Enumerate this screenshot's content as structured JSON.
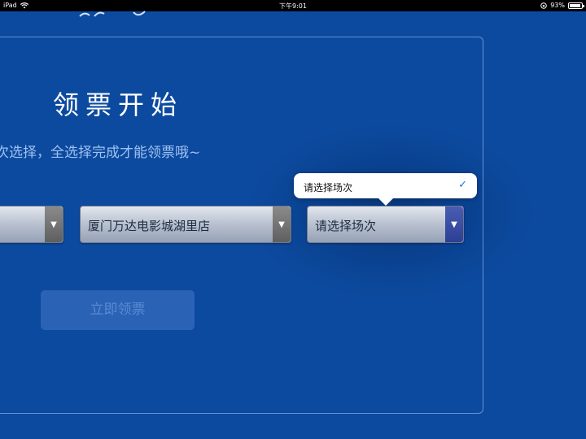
{
  "status_bar": {
    "device": "iPad",
    "wifi_icon": "wifi-icon",
    "time": "下午9:01",
    "battery_percent": "93%",
    "battery_level": 0.93,
    "rotation_lock_icon": "rotation-lock-icon"
  },
  "main": {
    "title": "领票开始",
    "subtitle": "次选择，全选择完成才能领票哦~",
    "selects": [
      {
        "value": "",
        "arrow_icon": "dropdown-arrow-icon"
      },
      {
        "value": "厦门万达电影城湖里店",
        "arrow_icon": "dropdown-arrow-icon"
      },
      {
        "value": "请选择场次",
        "arrow_icon": "dropdown-arrow-icon"
      }
    ],
    "claim_button": "立即领票"
  },
  "popover": {
    "option": "请选择场次",
    "selected": true,
    "check_icon": "checkmark-icon"
  },
  "colors": {
    "background": "#0c4a9f",
    "subtitle": "#9fc1ef",
    "button_bg": "#2a62b5",
    "button_text": "#5a8ad2",
    "check": "#1a73e8"
  }
}
